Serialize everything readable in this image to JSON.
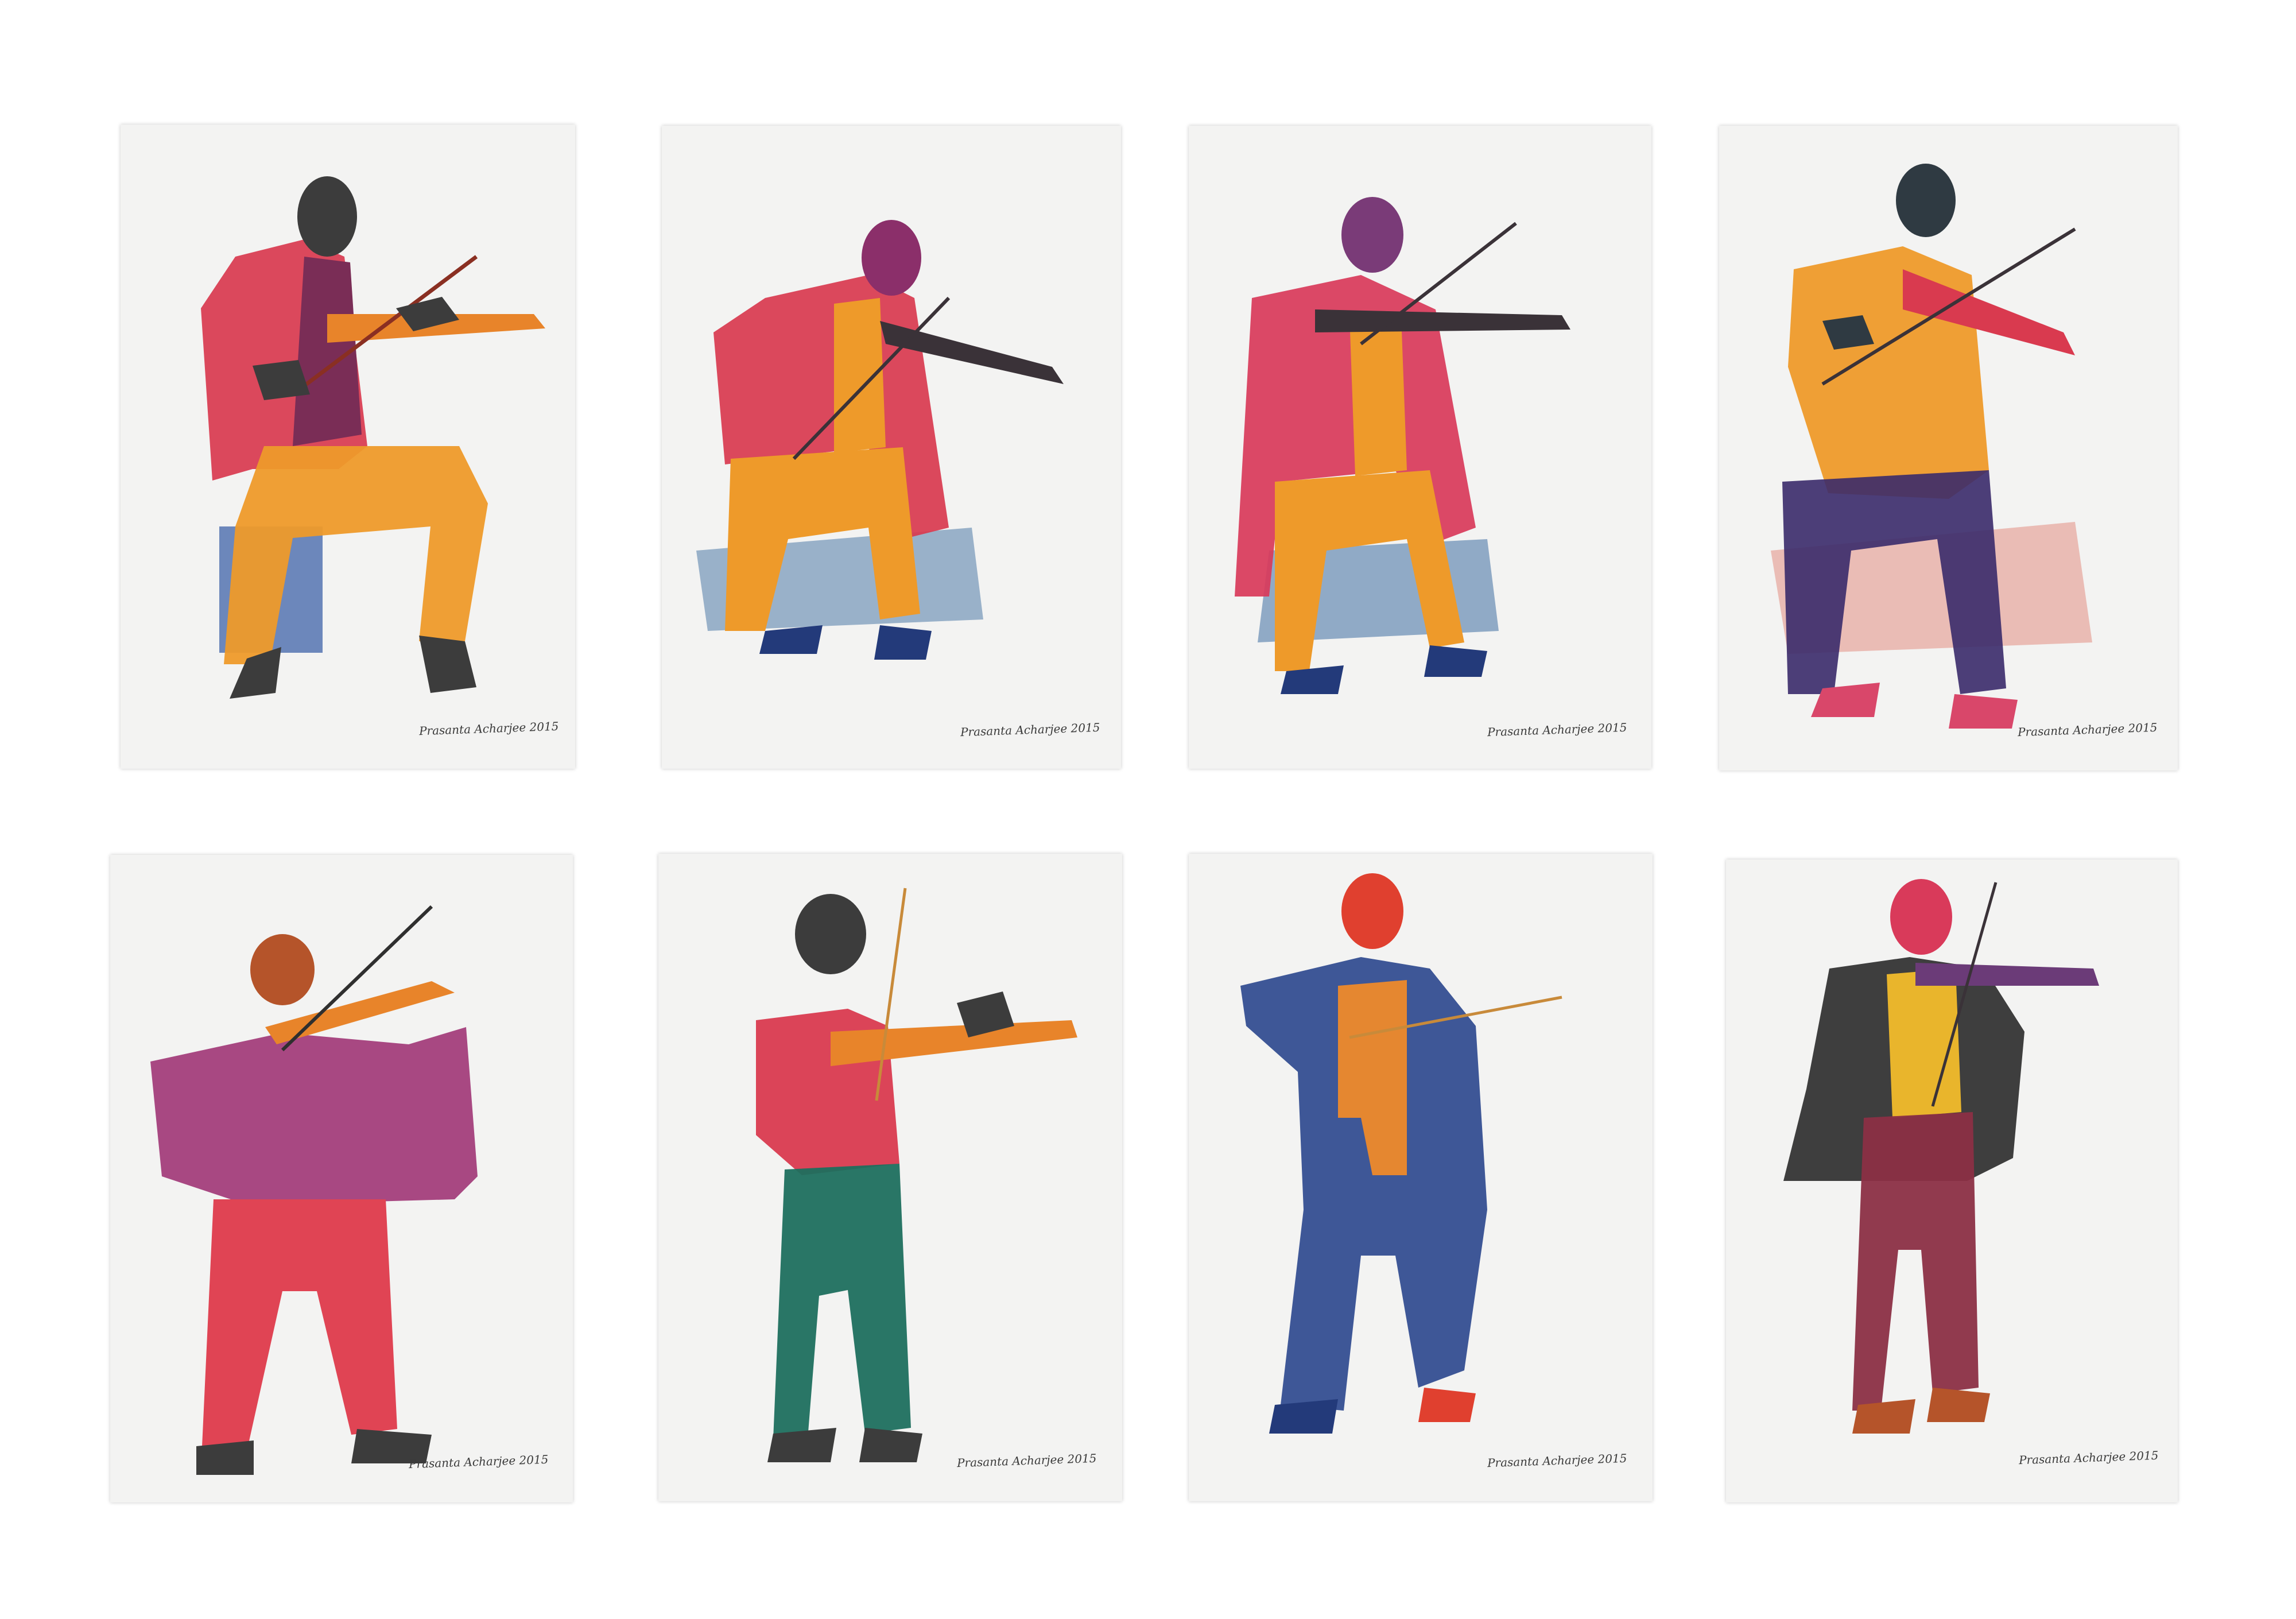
{
  "artwork": {
    "sheets": [
      {
        "signature": "Prasanta Acharjee 2015"
      },
      {
        "signature": "Prasanta Acharjee 2015"
      },
      {
        "signature": "Prasanta Acharjee 2015"
      },
      {
        "signature": "Prasanta Acharjee 2015"
      },
      {
        "signature": "Prasanta Acharjee 2015"
      },
      {
        "signature": "Prasanta Acharjee 2015"
      },
      {
        "signature": "Prasanta Acharjee 2015"
      },
      {
        "signature": "Prasanta Acharjee 2015"
      }
    ],
    "palette": {
      "red": "#d93a4f",
      "orange": "#ee9a2a",
      "plum": "#7a2d56",
      "blue": "#2f4a8f",
      "charcoal": "#3c3c3c",
      "green": "#1e6f5e",
      "magenta": "#a23a78",
      "yellow": "#e9b52c"
    }
  }
}
